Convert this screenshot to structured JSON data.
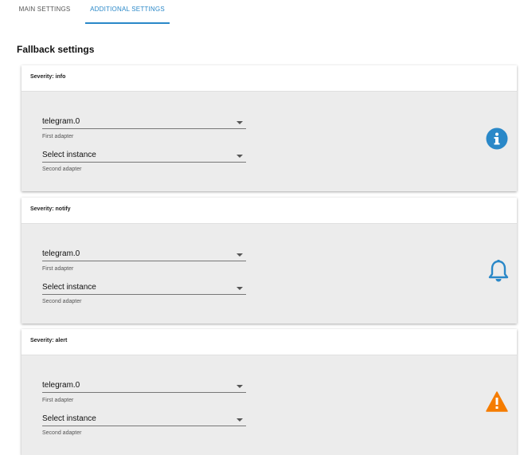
{
  "tabs": {
    "main": "MAIN SETTINGS",
    "additional": "ADDITIONAL SETTINGS"
  },
  "page": {
    "heading": "Fallback settings"
  },
  "cards": [
    {
      "title": "Severity: info",
      "first_value": "telegram.0",
      "first_label": "First adapter",
      "second_value": "Select instance",
      "second_label": "Second adapter",
      "icon": "info-icon",
      "icon_color": "#2a88c8"
    },
    {
      "title": "Severity: notify",
      "first_value": "telegram.0",
      "first_label": "First adapter",
      "second_value": "Select instance",
      "second_label": "Second adapter",
      "icon": "bell-icon",
      "icon_color": "#2a88c8"
    },
    {
      "title": "Severity: alert",
      "first_value": "telegram.0",
      "first_label": "First adapter",
      "second_value": "Select instance",
      "second_label": "Second adapter",
      "icon": "warning-icon",
      "icon_color": "#f57c00"
    }
  ]
}
